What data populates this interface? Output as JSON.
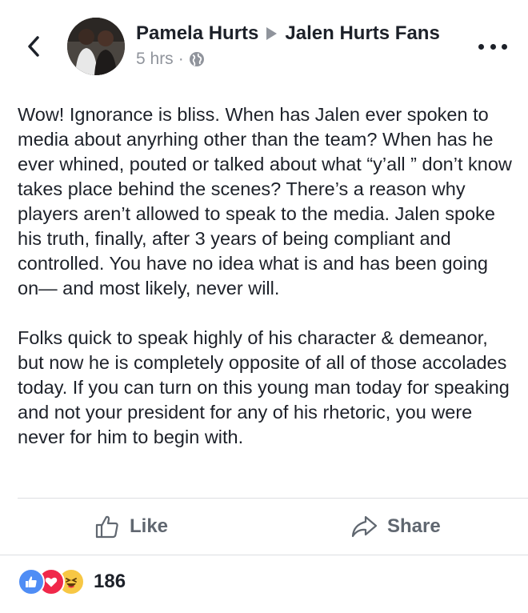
{
  "header": {
    "author": "Pamela Hurts",
    "group": "Jalen Hurts Fans",
    "time": "5 hrs",
    "separator": "·"
  },
  "post": {
    "paragraphs": [
      "Wow! Ignorance is bliss. When has Jalen ever spoken to media about anyrhing other than the team? When has he ever whined, pouted or talked about what “y’all ” don’t know takes place behind the scenes? There’s a reason why players aren’t allowed to speak to the media. Jalen spoke his truth, finally, after 3 years of being compliant and controlled.  You have no idea what is and has been going on— and most likely, never will.",
      "Folks quick to speak highly of his character & demeanor, but now he is completely opposite of all of those accolades today. If you can turn on this young man today for speaking and not your president for any of his rhetoric, you were never for him to begin with."
    ]
  },
  "actions": {
    "like_label": "Like",
    "share_label": "Share"
  },
  "reactions": {
    "icons": [
      "like-icon",
      "love-icon",
      "haha-icon"
    ],
    "count": "186"
  },
  "colors": {
    "text": "#1d2129",
    "secondary": "#90949c",
    "action": "#606770",
    "like_blue": "#4f8df5",
    "love_red": "#f0284a",
    "haha_yellow": "#f7c744"
  }
}
